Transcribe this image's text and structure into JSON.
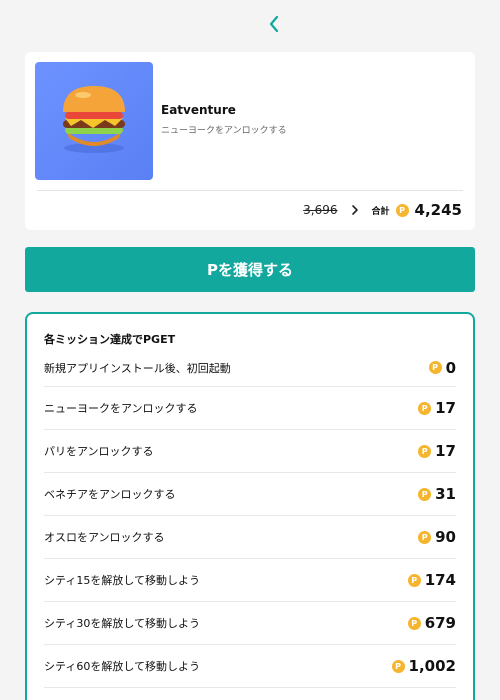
{
  "header": {
    "back_icon": "chevron-left-icon",
    "accent": "#13a89e"
  },
  "app": {
    "name": "Eatventure",
    "subtitle": "ニューヨークをアンロックする",
    "icon": "burger-icon",
    "icon_bg": "#6d92ff"
  },
  "price": {
    "old": "3,696",
    "total_label": "合計",
    "total": "4,245",
    "coin_glyph": "P"
  },
  "cta": {
    "label": "Pを獲得する"
  },
  "missions": {
    "title": "各ミッション達成でPGET",
    "items": [
      {
        "label": "新規アプリインストール後、初回起動",
        "reward": "0"
      },
      {
        "label": "ニューヨークをアンロックする",
        "reward": "17"
      },
      {
        "label": "パリをアンロックする",
        "reward": "17"
      },
      {
        "label": "ベネチアをアンロックする",
        "reward": "31"
      },
      {
        "label": "オスロをアンロックする",
        "reward": "90"
      },
      {
        "label": "シティ15を解放して移動しよう",
        "reward": "174"
      },
      {
        "label": "シティ30を解放して移動しよう",
        "reward": "679"
      },
      {
        "label": "シティ60を解放して移動しよう",
        "reward": "1,002"
      }
    ]
  }
}
